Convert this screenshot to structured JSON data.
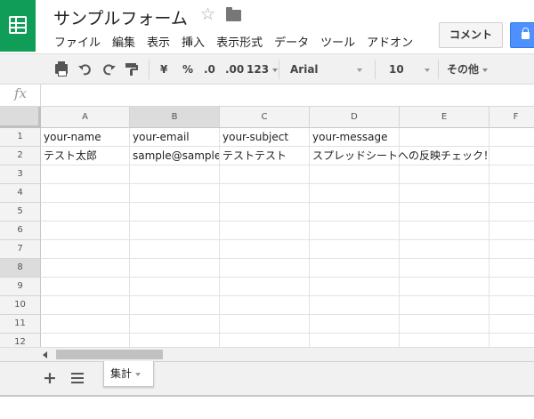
{
  "app": {
    "icon": "sheets-grid-icon",
    "brand_color": "#0f9d58",
    "doc_title": "サンプルフォーム",
    "star_glyph": "☆",
    "menu": [
      "ファイル",
      "編集",
      "表示",
      "挿入",
      "表示形式",
      "データ",
      "ツール",
      "アドオン"
    ],
    "comment_label": "コメント",
    "share_color": "#4d90fe"
  },
  "toolbar": {
    "currency": "¥",
    "percent": "%",
    "decrease_decimal": ".0",
    "increase_decimal": ".00",
    "number_format": "123",
    "font": "Arial",
    "font_size": "10",
    "more": "その他"
  },
  "formula": {
    "fx_label": "fx",
    "value": ""
  },
  "sheet": {
    "columns": [
      "A",
      "B",
      "C",
      "D",
      "E",
      "F"
    ],
    "selected_column": "B",
    "rows": [
      "1",
      "2",
      "3",
      "4",
      "5",
      "6",
      "7",
      "8",
      "9",
      "10",
      "11",
      "12"
    ],
    "selected_row": "8",
    "cells": {
      "A1": "your-name",
      "B1": "your-email",
      "C1": "your-subject",
      "D1": "your-message",
      "A2": "テスト太郎",
      "B2": "sample@sample",
      "C2": "テストテスト",
      "D2": "スプレッドシートへの反映チェック！"
    }
  },
  "tabs": {
    "active": "集計"
  }
}
